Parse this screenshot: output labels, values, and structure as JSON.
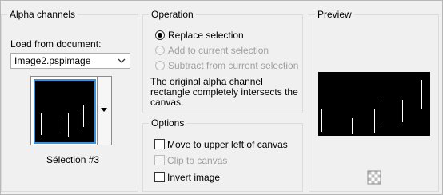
{
  "alpha_channels": {
    "title": "Alpha channels",
    "load_label": "Load from document:",
    "document_select_value": "Image2.pspimage",
    "thumbnail_label": "Sélection #3"
  },
  "operation": {
    "title": "Operation",
    "options": [
      {
        "label": "Replace selection",
        "selected": true,
        "enabled": true
      },
      {
        "label": "Add to current selection",
        "selected": false,
        "enabled": false
      },
      {
        "label": "Subtract from current selection",
        "selected": false,
        "enabled": false
      }
    ],
    "description": "The original alpha channel rectangle completely intersects the canvas."
  },
  "options": {
    "title": "Options",
    "items": [
      {
        "label": "Move to upper left of canvas",
        "checked": false,
        "enabled": true
      },
      {
        "label": "Clip to canvas",
        "checked": false,
        "enabled": false
      },
      {
        "label": "Invert image",
        "checked": false,
        "enabled": true
      }
    ]
  },
  "preview": {
    "title": "Preview",
    "checker_icon": "transparency-checker-icon"
  },
  "colors": {
    "selection_accent": "#3d8fd9",
    "disabled_text": "#a0a0a0"
  }
}
